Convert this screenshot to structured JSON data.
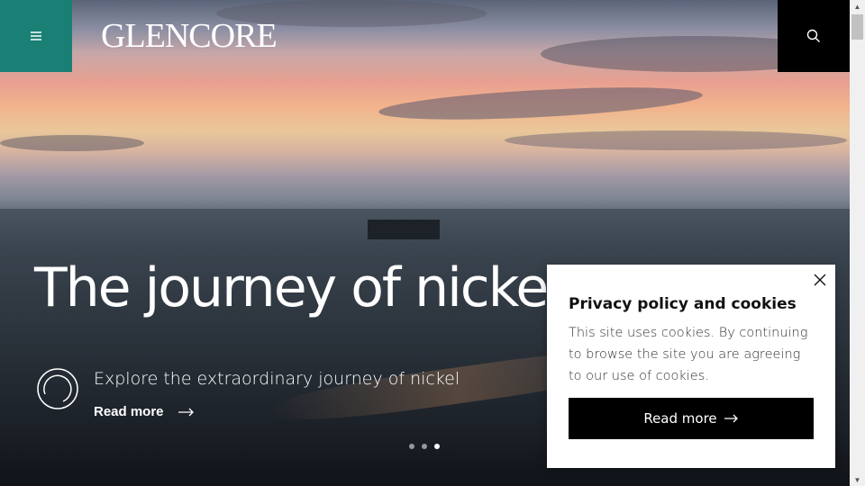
{
  "header": {
    "logo_text": "GLENCORE",
    "menu_icon": "hamburger-menu-icon",
    "search_icon": "search-icon",
    "menu_color": "#1a7f74"
  },
  "hero": {
    "title": "The journey of nickel",
    "subtitle": "Explore the extraordinary journey of nickel",
    "read_more_label": "Read more",
    "slides_total": 3,
    "active_slide": 3
  },
  "cookie_modal": {
    "title": "Privacy policy and cookies",
    "text": "This site uses cookies. By continuing to browse the site you are agreeing to our use of cookies.",
    "button_label": "Read more"
  }
}
